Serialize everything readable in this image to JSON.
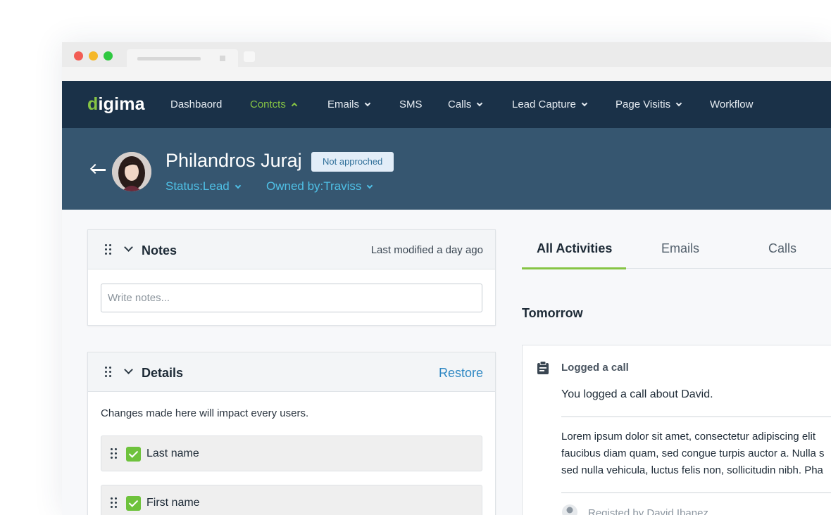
{
  "brand": {
    "logo_initial": "d",
    "logo_rest": "igima",
    "accent": "#86c444",
    "nav_bg": "#1a3148",
    "header_bg": "#365670"
  },
  "nav": {
    "items": [
      {
        "label": "Dashbaord",
        "dropdown": false
      },
      {
        "label": "Contcts",
        "dropdown": true,
        "active": true
      },
      {
        "label": "Emails",
        "dropdown": true
      },
      {
        "label": "SMS",
        "dropdown": false
      },
      {
        "label": "Calls",
        "dropdown": true
      },
      {
        "label": "Lead Capture",
        "dropdown": true
      },
      {
        "label": "Page Visitis",
        "dropdown": true
      },
      {
        "label": "Workflow",
        "dropdown": false
      }
    ]
  },
  "contact": {
    "name": "Philandros Juraj",
    "badge": "Not approched",
    "status": "Status:Lead",
    "owner": "Owned by:Traviss"
  },
  "notes": {
    "title": "Notes",
    "modified": "Last modified a day ago",
    "placeholder": "Write notes..."
  },
  "details": {
    "title": "Details",
    "restore_label": "Restore",
    "note": "Changes made here will impact every users.",
    "fields": [
      {
        "label": "Last name",
        "checked": true
      },
      {
        "label": "First name",
        "checked": true
      }
    ]
  },
  "activity": {
    "tabs": [
      "All Activities",
      "Emails",
      "Calls"
    ],
    "section": "Tomorrow",
    "item": {
      "title": "Logged a call",
      "text": "You logged a call about David.",
      "body_lines": [
        "Lorem ipsum dolor sit amet, consectetur adipiscing elit",
        "faucibus diam quam, sed congue turpis auctor a. Nulla s",
        "sed nulla vehicula, luctus felis non, sollicitudin nibh. Pha"
      ],
      "registered": "Registed by David Ibanez"
    }
  }
}
